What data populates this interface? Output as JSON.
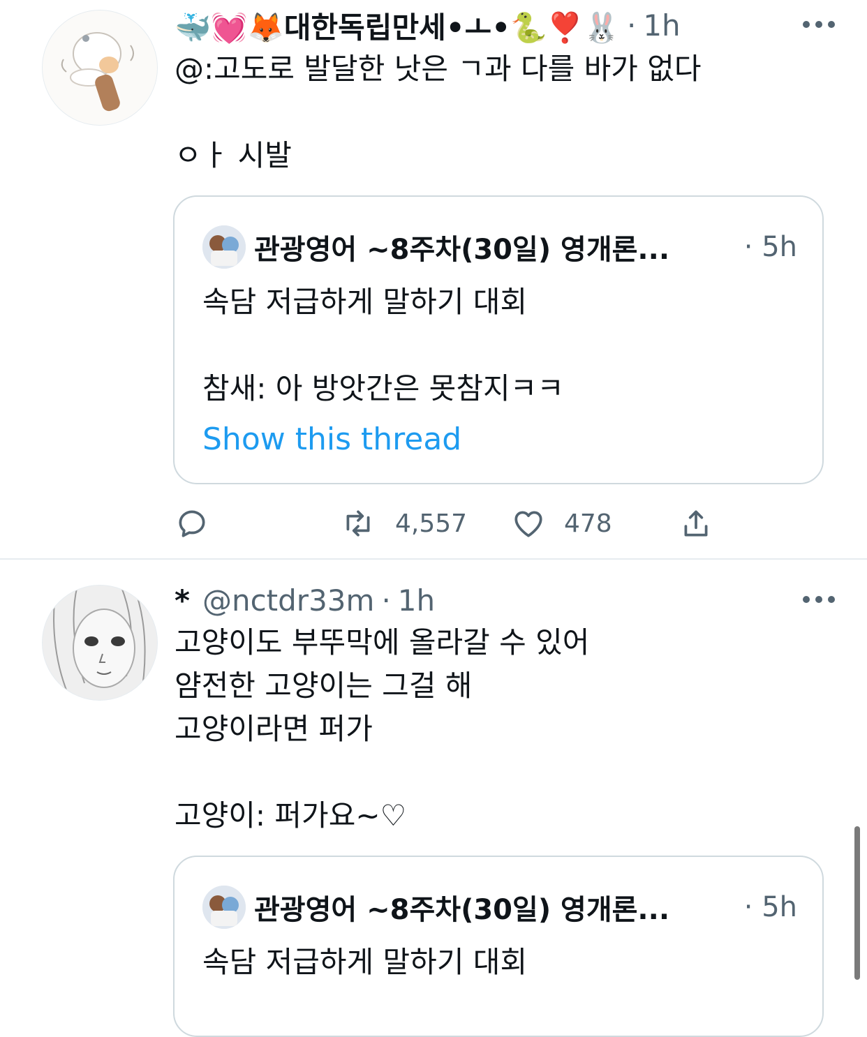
{
  "tweets": [
    {
      "display_name": "🐳💓🦊대한독립만세•ㅗ•🐍❣️🐰",
      "handle": "",
      "dot": "·",
      "time": "1h",
      "text": "@:고도로 발달한 낫은 ㄱ과 다를 바가 없다\n\nㅇㅏ 시발",
      "quote": {
        "name": "관광영어 ~8주차(30일) 영개론...",
        "dot": "·",
        "time": "5h",
        "text": "속담 저급하게 말하기 대회\n\n참새: 아 방앗간은 못참지ㅋㅋ",
        "show_thread": "Show this thread"
      },
      "actions": {
        "retweets": "4,557",
        "likes": "478"
      }
    },
    {
      "display_name": "*",
      "handle": "@nctdr33m",
      "dot": "·",
      "time": "1h",
      "text": "고양이도 부뚜막에 올라갈 수 있어\n얌전한 고양이는 그걸 해\n고양이라면 퍼가\n\n고양이: 퍼가요~♡",
      "quote": {
        "name": "관광영어 ~8주차(30일) 영개론...",
        "dot": "·",
        "time": "5h",
        "text": "속담 저급하게 말하기 대회"
      }
    }
  ],
  "icons": {
    "reply": "reply-icon",
    "retweet": "retweet-icon",
    "like": "heart-icon",
    "share": "share-icon",
    "more": "more-icon"
  },
  "colors": {
    "link": "#1d9bf0",
    "secondary_text": "#536471",
    "border": "#cfd9de"
  }
}
